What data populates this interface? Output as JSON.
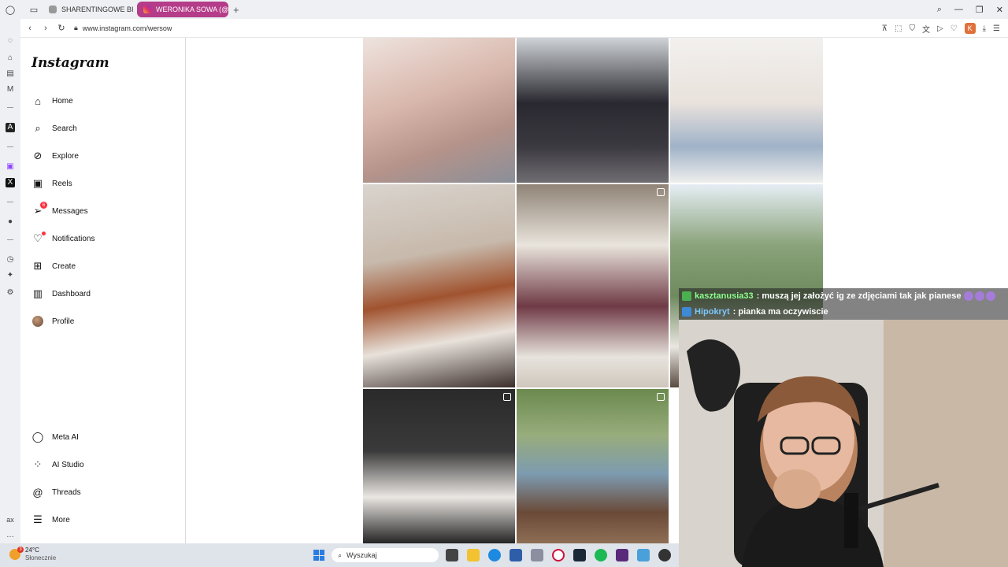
{
  "browser": {
    "tabs": [
      {
        "label": "SHARENTINGOWE BINGO",
        "active": false
      },
      {
        "label": "WERONIKA SOWA (@wersow)",
        "active": true
      }
    ],
    "url": "www.instagram.com/wersow",
    "profile_initial": "K",
    "accent_color": "#b43c89"
  },
  "instagram": {
    "logo": "Instagram",
    "nav": [
      {
        "label": "Home",
        "icon": "home-icon"
      },
      {
        "label": "Search",
        "icon": "search-icon"
      },
      {
        "label": "Explore",
        "icon": "compass-icon"
      },
      {
        "label": "Reels",
        "icon": "reels-icon"
      },
      {
        "label": "Messages",
        "icon": "messenger-icon",
        "badge": "6"
      },
      {
        "label": "Notifications",
        "icon": "heart-icon"
      },
      {
        "label": "Create",
        "icon": "plus-square-icon"
      },
      {
        "label": "Dashboard",
        "icon": "chart-icon"
      },
      {
        "label": "Profile",
        "icon": "avatar-icon"
      }
    ],
    "bottom_nav": [
      {
        "label": "Meta AI",
        "icon": "meta-ai-icon"
      },
      {
        "label": "AI Studio",
        "icon": "ai-studio-icon"
      },
      {
        "label": "Threads",
        "icon": "threads-icon"
      },
      {
        "label": "More",
        "icon": "hamburger-icon"
      }
    ]
  },
  "stream_chat": [
    {
      "user": "kasztanusia33",
      "message": ": muszą jej założyć ig ze zdjęciami tak jak pianese"
    },
    {
      "user": "Hipokryt",
      "message": ": pianka ma oczywiscie"
    }
  ],
  "taskbar": {
    "weather_badge": "3",
    "temperature": "24°C",
    "weather_desc": "Słonecznie",
    "search_placeholder": "Wyszukaj"
  }
}
